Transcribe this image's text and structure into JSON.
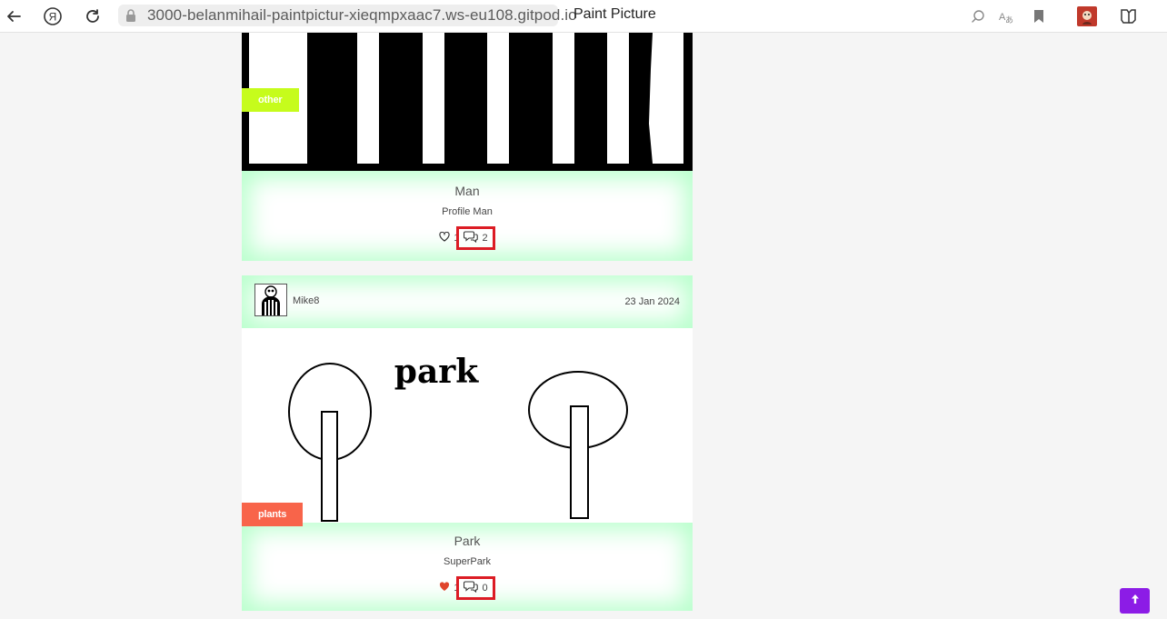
{
  "browser": {
    "url": "3000-belanmihail-paintpictur-xieqmpxaac7.ws-eu108.gitpod.io",
    "title": "Paint Picture"
  },
  "posts": [
    {
      "category": "other",
      "title": "Man",
      "description": "Profile Man",
      "likes": "1",
      "comments": "2"
    },
    {
      "author": "Mike8",
      "date": "23 Jan 2024",
      "image_text": "park",
      "category": "plants",
      "title": "Park",
      "description": "SuperPark",
      "likes": "1",
      "comments": "0"
    }
  ],
  "colors": {
    "accent": "#8c1ce6",
    "other_badge": "#c6fc1c",
    "plants_badge": "#f8644a",
    "highlight_box": "#dc1c24",
    "card_glow": "#b8ffcc"
  },
  "icons": [
    "back-arrow-icon",
    "yandex-icon",
    "reload-icon",
    "lock-icon",
    "search-page-icon",
    "translate-icon",
    "bookmark-icon",
    "extension-avatar-icon",
    "reader-icon",
    "heart-icon",
    "comments-icon",
    "arrow-up-icon"
  ]
}
